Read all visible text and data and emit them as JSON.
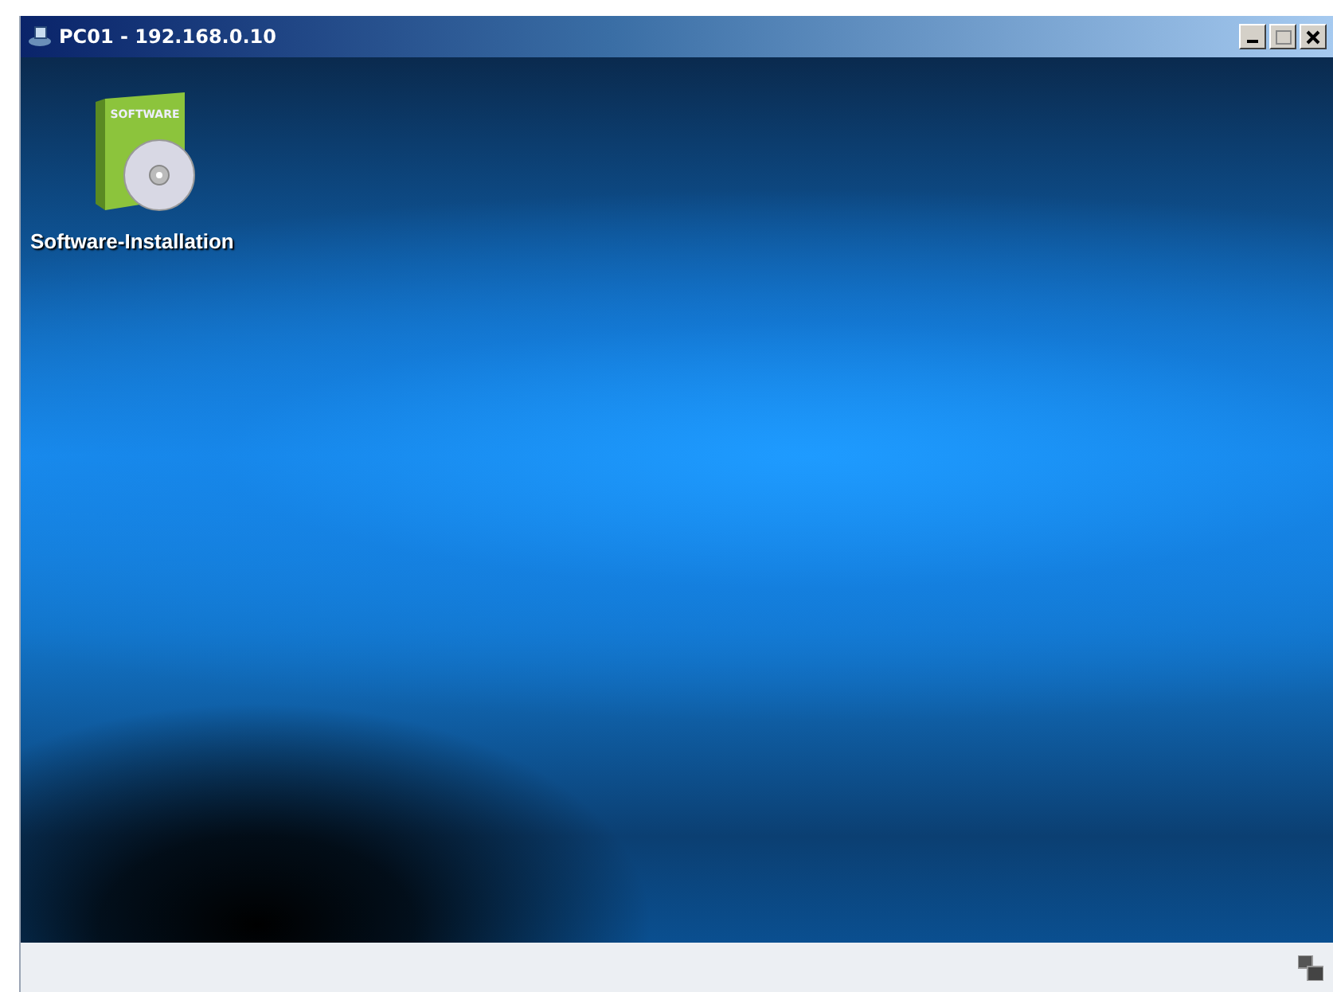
{
  "window": {
    "title": "PC01 - 192.168.0.10"
  },
  "desktop_icons": [
    {
      "label": "Software-Installation",
      "box_text": "SOFTWARE"
    }
  ]
}
